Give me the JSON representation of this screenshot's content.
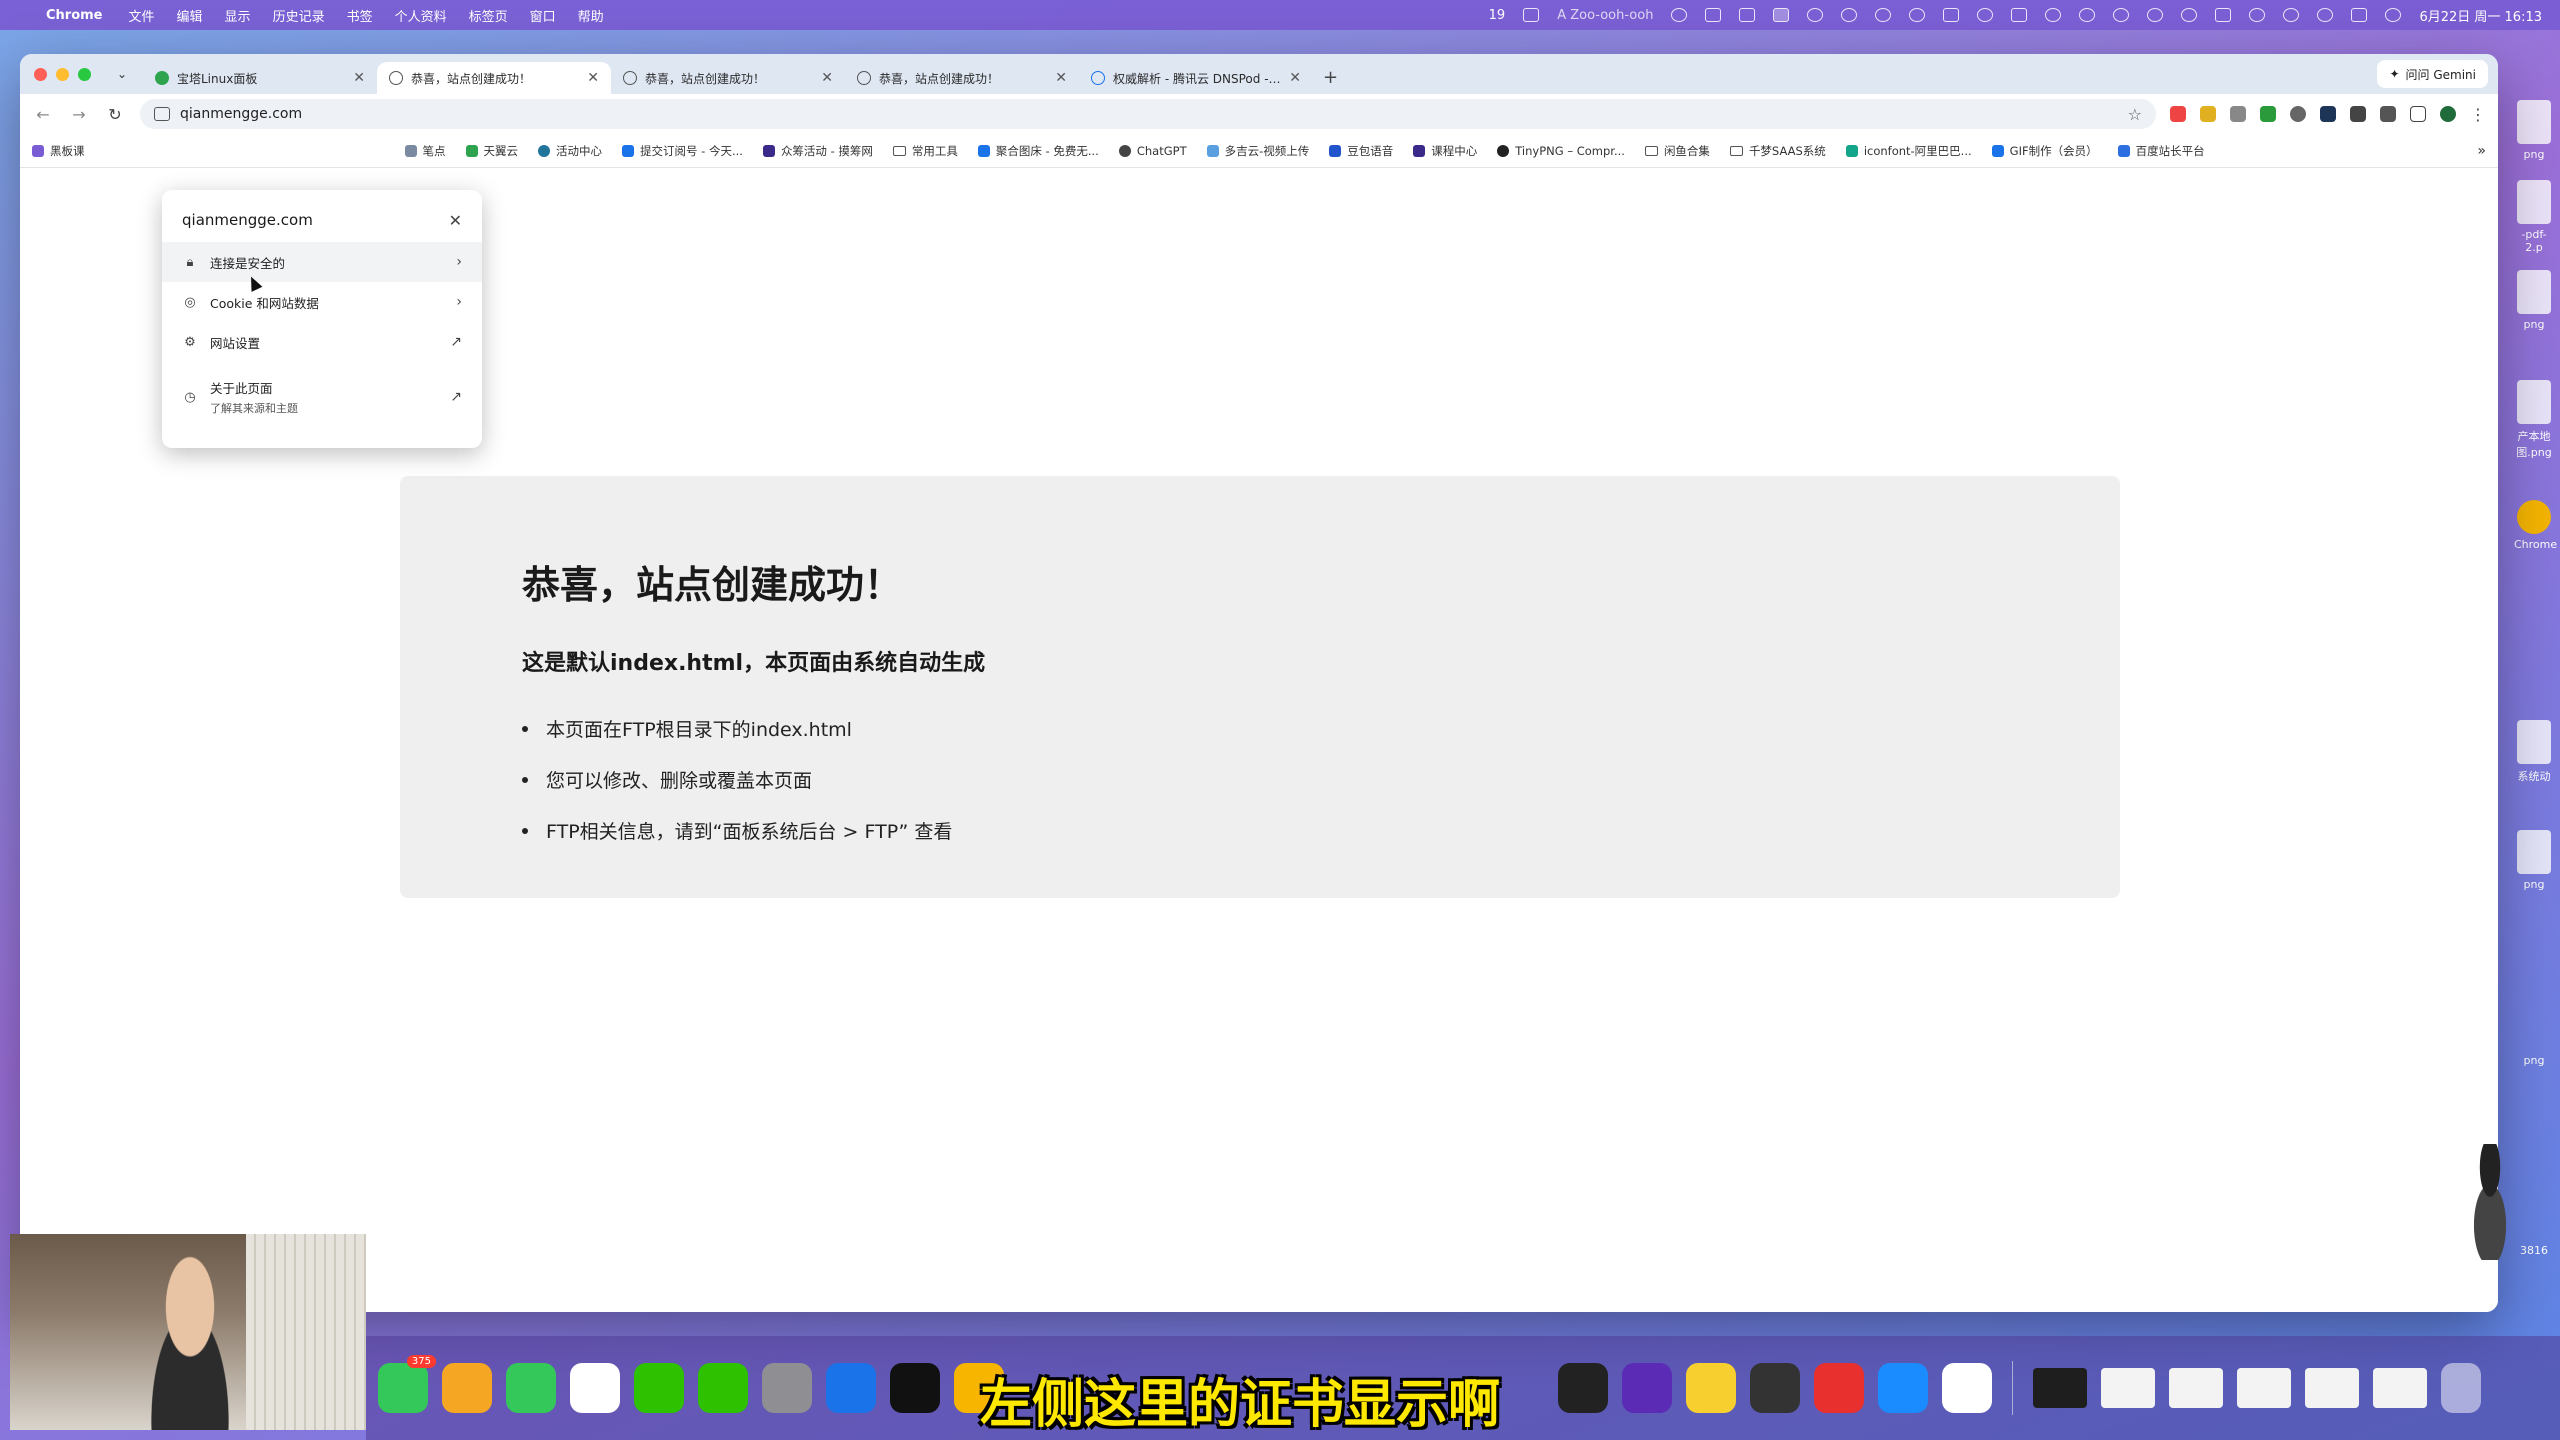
{
  "menubar": {
    "app": "Chrome",
    "menus": [
      "文件",
      "编辑",
      "显示",
      "历史记录",
      "书签",
      "个人资料",
      "标签页",
      "窗口",
      "帮助"
    ],
    "status_text": "A Zoo-ooh-ooh",
    "badge_count": "19",
    "clock": "6月22日 周一 16:13"
  },
  "tabs": [
    {
      "title": "宝塔Linux面板",
      "favicon": "green-circle",
      "active": false
    },
    {
      "title": "恭喜，站点创建成功！",
      "favicon": "globe",
      "active": true
    },
    {
      "title": "恭喜，站点创建成功！",
      "favicon": "globe",
      "active": false
    },
    {
      "title": "恭喜，站点创建成功！",
      "favicon": "globe",
      "active": false
    },
    {
      "title": "权威解析 - 腾讯云 DNSPod - …",
      "favicon": "cloud",
      "active": false
    }
  ],
  "gemini_label": "问问 Gemini",
  "address": "qianmengge.com",
  "bookmarks": [
    {
      "label": "黑板课"
    },
    {
      "label": "笔点"
    },
    {
      "label": "天翼云"
    },
    {
      "label": "活动中心"
    },
    {
      "label": "提交订阅号 - 今天..."
    },
    {
      "label": "众筹活动 - 摸筹网"
    },
    {
      "label": "常用工具",
      "folder": true
    },
    {
      "label": "聚合图床 - 免费无..."
    },
    {
      "label": "ChatGPT"
    },
    {
      "label": "多吉云-视频上传"
    },
    {
      "label": "豆包语音"
    },
    {
      "label": "课程中心"
    },
    {
      "label": "TinyPNG – Compr..."
    },
    {
      "label": "闲鱼合集",
      "folder": true
    },
    {
      "label": "千梦SAAS系统",
      "folder": true
    },
    {
      "label": "iconfont-阿里巴巴..."
    },
    {
      "label": "GIF制作（会员）"
    },
    {
      "label": "百度站长平台"
    }
  ],
  "popup": {
    "domain": "qianmengge.com",
    "connection": "连接是安全的",
    "cookies": "Cookie 和网站数据",
    "site_settings": "网站设置",
    "about": "关于此页面",
    "about_sub": "了解其来源和主题"
  },
  "page": {
    "title": "恭喜，站点创建成功！",
    "subtitle": "这是默认index.html，本页面由系统自动生成",
    "items": [
      "本页面在FTP根目录下的index.html",
      "您可以修改、删除或覆盖本页面",
      "FTP相关信息，请到“面板系统后台 > FTP” 查看"
    ]
  },
  "desktop_icons": [
    {
      "label": "png"
    },
    {
      "label": "-pdf-2.p"
    },
    {
      "label": "png"
    },
    {
      "label": "产本地图.png"
    },
    {
      "label": "Chrome"
    },
    {
      "label": "系统动"
    },
    {
      "label": "png"
    },
    {
      "label": "png"
    },
    {
      "label": "3816"
    }
  ],
  "dock": {
    "messages_badge": "375",
    "apps": [
      {
        "name": "messages",
        "color": "#34c759"
      },
      {
        "name": "photos",
        "color": "#f5a623"
      },
      {
        "name": "phone",
        "color": "#34c759"
      },
      {
        "name": "chrome",
        "color": "#ffffff"
      },
      {
        "name": "wechat",
        "color": "#2dc100"
      },
      {
        "name": "wechat-2",
        "color": "#2dc100"
      },
      {
        "name": "settings",
        "color": "#8e8e93"
      },
      {
        "name": "feishu",
        "color": "#1a73e8"
      },
      {
        "name": "capcut",
        "color": "#111111"
      },
      {
        "name": "sketch",
        "color": "#f7b500"
      },
      {
        "name": "obs",
        "color": "#222222"
      },
      {
        "name": "affinity",
        "color": "#5b2bb5"
      },
      {
        "name": "maps",
        "color": "#f7d030"
      },
      {
        "name": "calculator",
        "color": "#333333"
      },
      {
        "name": "wps",
        "color": "#e8302e"
      },
      {
        "name": "qq-browser",
        "color": "#1a8cff"
      },
      {
        "name": "chrome-2",
        "color": "#ffffff"
      }
    ]
  },
  "subtitle_caption": "左侧这里的证书显示啊"
}
